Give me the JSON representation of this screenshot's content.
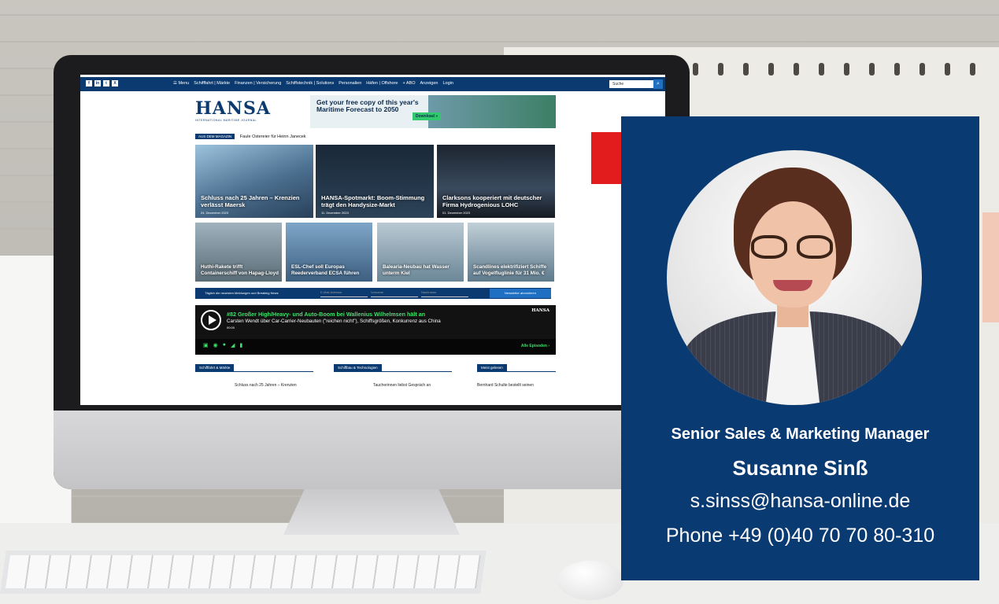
{
  "website": {
    "social_icons": [
      "f",
      "in",
      "t",
      "X"
    ],
    "nav_items": [
      "☰ Menu",
      "Schifffahrt | Märkte",
      "Finanzen | Versicherung",
      "Schiffstechnik | Solutions",
      "Personalien",
      "Häfen | Offshore",
      "+ ABO",
      "Anzeigen",
      "Login"
    ],
    "search_placeholder": "Suche",
    "logo": "HANSA",
    "logo_subtitle": "INTERNATIONAL MARITIME JOURNAL",
    "banner": {
      "text": "Get your free copy of this year's Maritime Forecast to 2050",
      "button": "Download »"
    },
    "magazine_tag": "AUS DEM MAGAZIN",
    "magazine_headline": "Faule Ostereier für Heinn Janecek",
    "top_tiles": [
      {
        "title": "Schluss nach 25 Jahren – Krenzien verlässt Maersk",
        "date": "24. Dezember 2023"
      },
      {
        "title": "HANSA-Spotmarkt: Boom-Stimmung trägt den Handysize-Markt",
        "date": "11. Dezember 2023"
      },
      {
        "title": "Clarksons kooperiert mit deutscher Firma Hydrogenious LOHC",
        "date": "01. Dezember 2023"
      }
    ],
    "bottom_tiles": [
      {
        "title": "Huthi-Rakete trifft Containerschiff von Hapag-Lloyd"
      },
      {
        "title": "ESL-Chef soll Europas Reederverband ECSA führen"
      },
      {
        "title": "Balearia-Neubau hat Wasser unterm Kiel"
      },
      {
        "title": "Scandlines elektrifiziert Schiffe auf Vogelfluglinie für 31 Mio. €"
      }
    ],
    "newsletter_text": "Täglich die neuesten Meldungen und Breaking News",
    "newsletter_fields": [
      "E-Mail-Adresse",
      "Vorname",
      "Nachname"
    ],
    "newsletter_button": "Newsletter abonnieren",
    "podcast": {
      "title": "#82 Großer High/Heavy- und Auto-Boom bei Wallenius Wilhelmsen hält an",
      "subtitle": "Carsten Wendt über Car-Carrier-Neubauten (\"reichen nicht\"), Schiffsgrößen, Konkurrenz aus China",
      "time": "00:00",
      "all_episodes": "Alle Episoden ›",
      "logo": "HANSA"
    },
    "sections": [
      "Schifffahrt & Märkte",
      "Schiffbau & Technologien",
      "Meist gelesen"
    ],
    "section_items": [
      "Schluss nach 25 Jahren – Krenzien",
      "Taucherinnen liebst Gespräch an",
      "Bernhard Schulte bestellt seinen"
    ]
  },
  "contact": {
    "role": "Senior Sales & Marketing Manager",
    "name": "Susanne Sinß",
    "email": "s.sinss@hansa-online.de",
    "phone": "Phone +49 (0)40 70 70 80-310"
  },
  "colors": {
    "card_blue": "#0a3a72",
    "nav_blue": "#0b3a70",
    "podcast_green": "#3ee06a"
  }
}
